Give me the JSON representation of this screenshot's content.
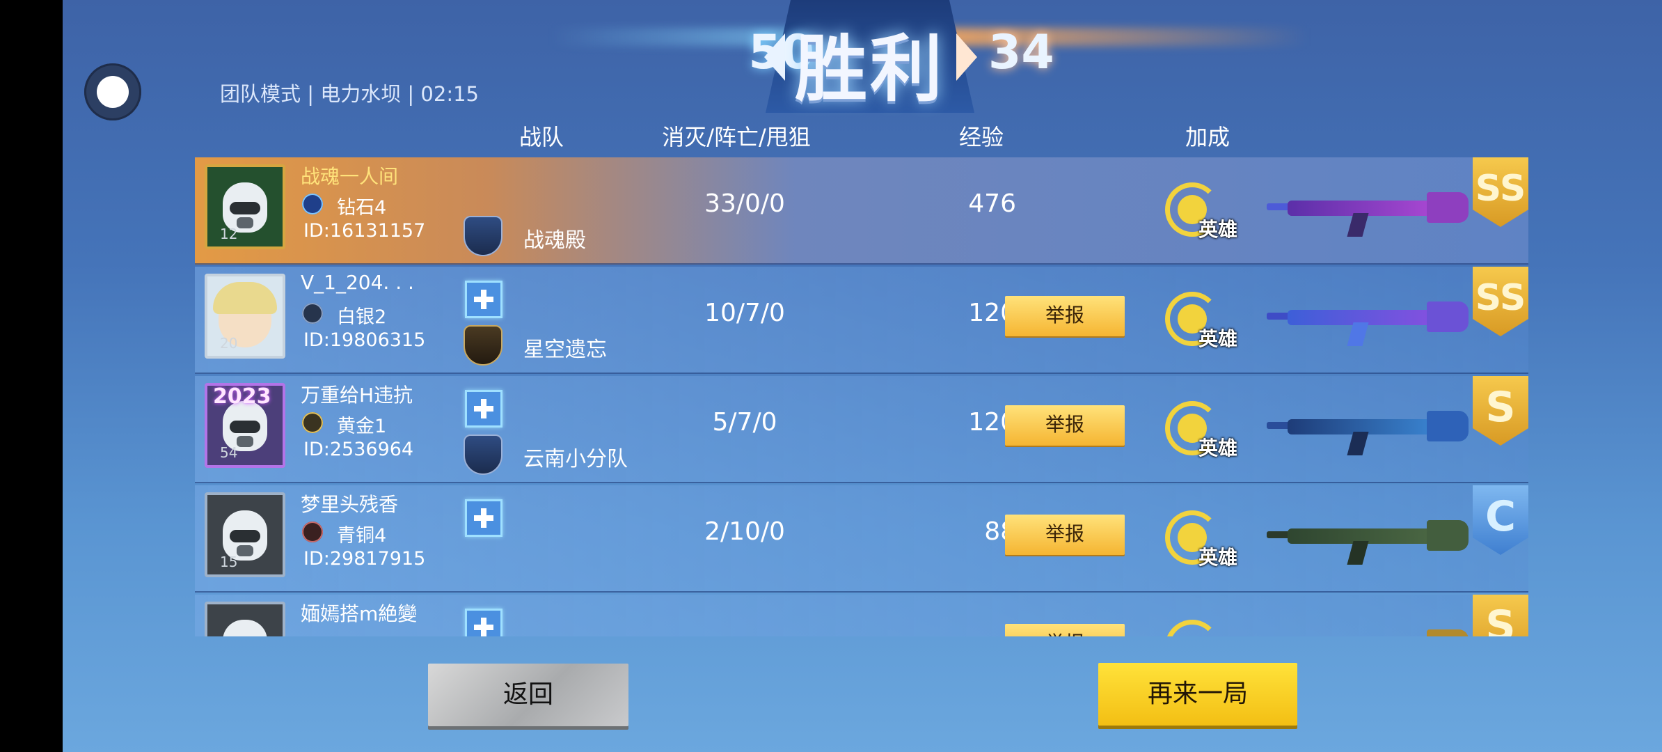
{
  "header": {
    "score_left": "50",
    "result": "胜利",
    "score_right": "34",
    "match_info": "团队模式 | 电力水坝 | 02:15"
  },
  "columns": {
    "team": "战队",
    "kda": "消灭/阵亡/甩狙",
    "exp": "经验",
    "bonus": "加成"
  },
  "players": [
    {
      "name": "战魂一人间",
      "level": "12",
      "rank": "钻石4",
      "id": "ID:16131157",
      "clan": "战魂殿",
      "kda": "33/0/0",
      "exp": "476",
      "report": "",
      "bonus": "英雄",
      "grade": "SS"
    },
    {
      "name": "V_1_204. . .",
      "level": "20",
      "rank": "白银2",
      "id": "ID:19806315",
      "clan": "星空遗忘",
      "kda": "10/7/0",
      "exp": "120",
      "report": "举报",
      "bonus": "英雄",
      "grade": "SS"
    },
    {
      "name": "万重给H违抗",
      "level": "54",
      "rank": "黄金1",
      "id": "ID:2536964",
      "clan": "云南小分队",
      "kda": "5/7/0",
      "exp": "120",
      "report": "举报",
      "bonus": "英雄",
      "grade": "S",
      "frame_badge": "2023"
    },
    {
      "name": "梦里头残香",
      "level": "15",
      "rank": "青铜4",
      "id": "ID:29817915",
      "clan": "",
      "kda": "2/10/0",
      "exp": "88",
      "report": "举报",
      "bonus": "英雄",
      "grade": "C"
    },
    {
      "name": "媔嫣搭m絶變",
      "level": "",
      "rank": "",
      "id": "",
      "clan": "",
      "kda": "",
      "exp": "",
      "report": "举报",
      "bonus": "",
      "grade": "S"
    }
  ],
  "buttons": {
    "back": "返回",
    "again": "再来一局"
  },
  "colors": {
    "accent_yellow": "#f5c21e",
    "background_blue": "#4574b9",
    "self_row_orange": "#e39a45"
  }
}
